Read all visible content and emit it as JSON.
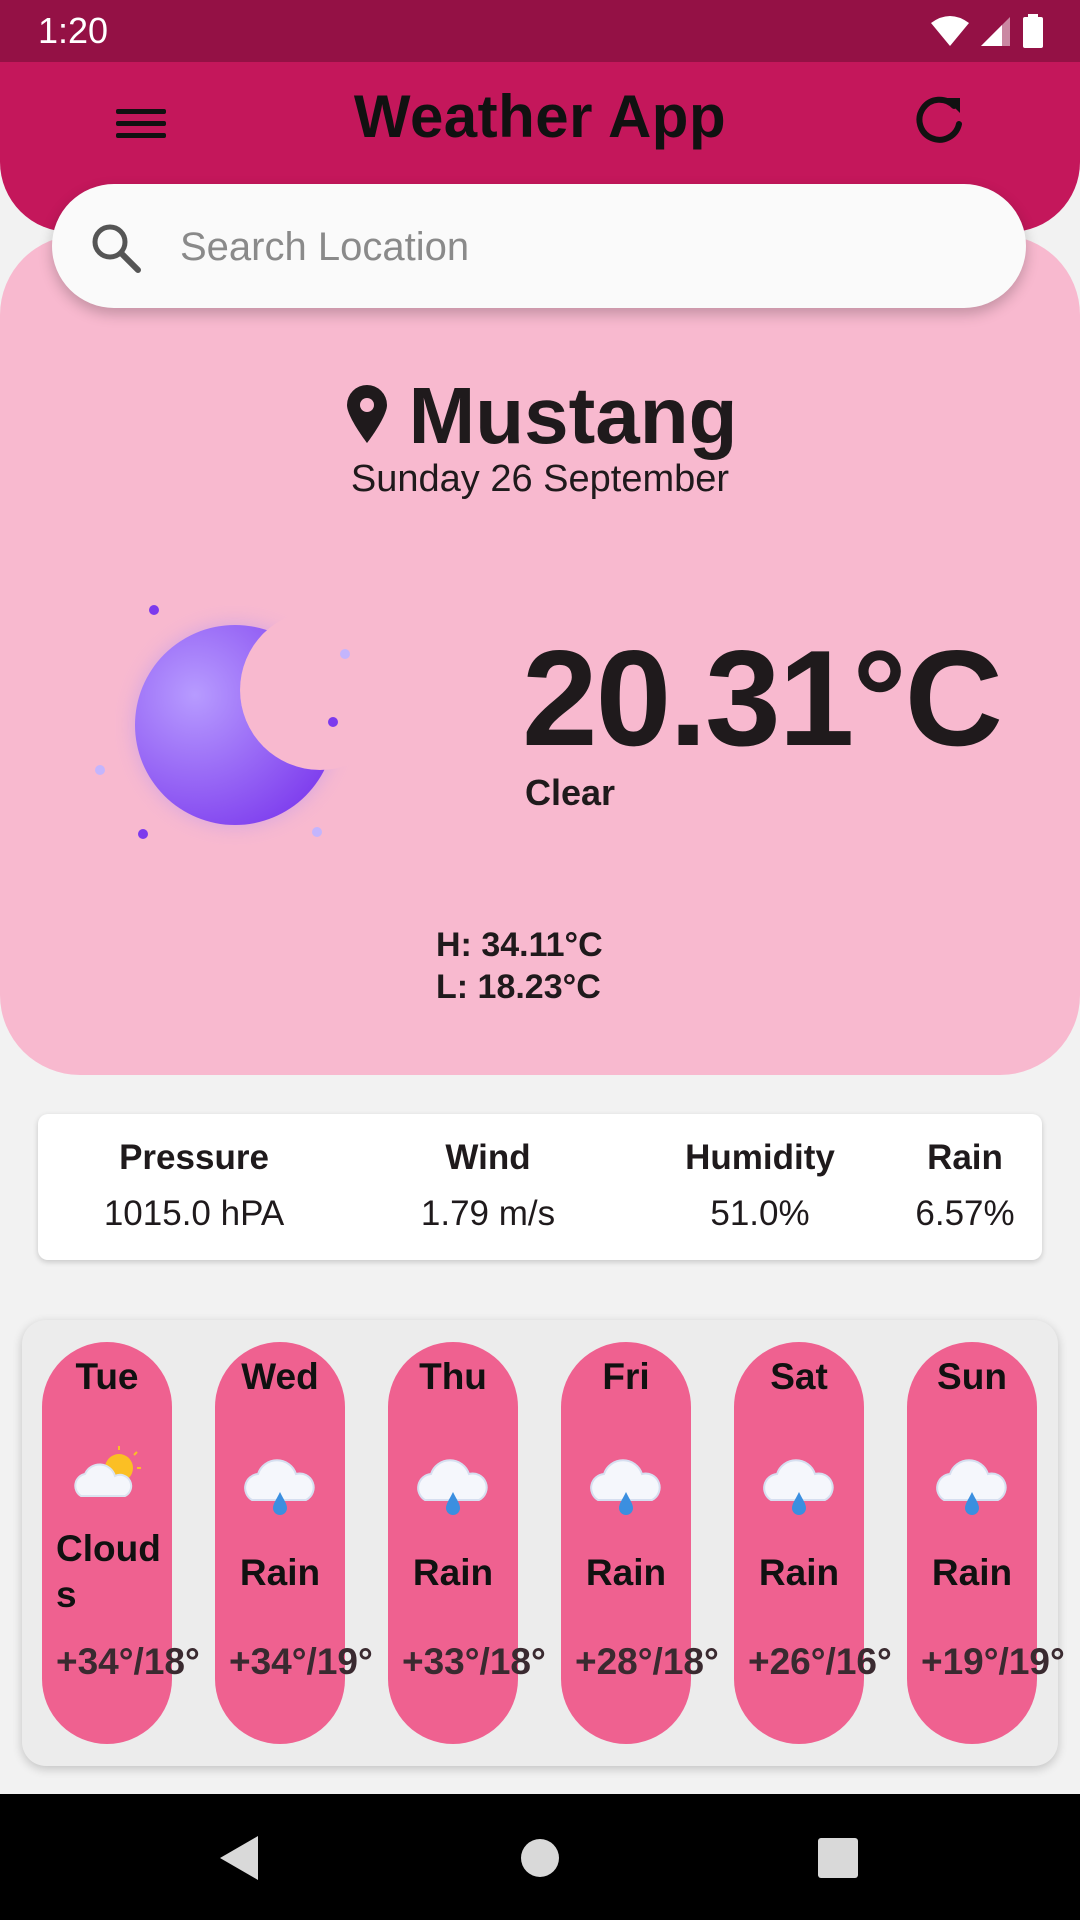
{
  "status_bar": {
    "time": "1:20"
  },
  "app_bar": {
    "title": "Weather App"
  },
  "search": {
    "placeholder": "Search Location",
    "value": ""
  },
  "location": {
    "city": "Mustang",
    "date": "Sunday 26 September"
  },
  "current": {
    "temperature": "20.31°C",
    "condition": "Clear",
    "high": "H: 34.11°C",
    "low": "L: 18.23°C",
    "icon": "moon-icon"
  },
  "stats": [
    {
      "label": "Pressure",
      "value": "1015.0 hPA"
    },
    {
      "label": "Wind",
      "value": "1.79 m/s"
    },
    {
      "label": "Humidity",
      "value": "51.0%"
    },
    {
      "label": "Rain",
      "value": "6.57%"
    }
  ],
  "forecast": [
    {
      "day": "Tue",
      "condition": "Clouds",
      "icon": "partly-cloudy-icon",
      "temp": "+34°/18°"
    },
    {
      "day": "Wed",
      "condition": "Rain",
      "icon": "rain-cloud-icon",
      "temp": "+34°/19°"
    },
    {
      "day": "Thu",
      "condition": "Rain",
      "icon": "rain-cloud-icon",
      "temp": "+33°/18°"
    },
    {
      "day": "Fri",
      "condition": "Rain",
      "icon": "rain-cloud-icon",
      "temp": "+28°/18°"
    },
    {
      "day": "Sat",
      "condition": "Rain",
      "icon": "rain-cloud-icon",
      "temp": "+26°/16°"
    },
    {
      "day": "Sun",
      "condition": "Rain",
      "icon": "rain-cloud-icon",
      "temp": "+19°/19°"
    }
  ],
  "colors": {
    "status_bar": "#941145",
    "app_bar": "#c4175b",
    "card": "#f8b9cf",
    "day_pill": "#ef6190",
    "moon": "#8b5cf6"
  }
}
